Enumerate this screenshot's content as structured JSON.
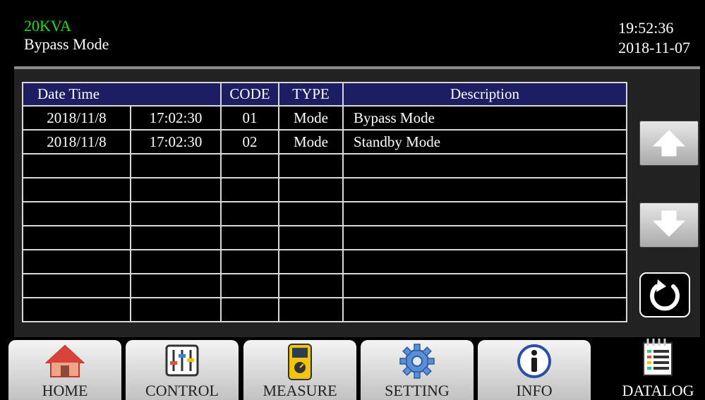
{
  "header": {
    "model": "20KVA",
    "mode": "Bypass Mode",
    "time": "19:52:36",
    "date": "2018-11-07"
  },
  "log_table": {
    "headers": {
      "datetime": "Date Time",
      "code": "CODE",
      "type": "TYPE",
      "description": "Description"
    },
    "rows": [
      {
        "date": "2018/11/8",
        "time": "17:02:30",
        "code": "01",
        "type": "Mode",
        "description": "Bypass Mode"
      },
      {
        "date": "2018/11/8",
        "time": "17:02:30",
        "code": "02",
        "type": "Mode",
        "description": "Standby Mode"
      },
      {
        "date": "",
        "time": "",
        "code": "",
        "type": "",
        "description": ""
      },
      {
        "date": "",
        "time": "",
        "code": "",
        "type": "",
        "description": ""
      },
      {
        "date": "",
        "time": "",
        "code": "",
        "type": "",
        "description": ""
      },
      {
        "date": "",
        "time": "",
        "code": "",
        "type": "",
        "description": ""
      },
      {
        "date": "",
        "time": "",
        "code": "",
        "type": "",
        "description": ""
      },
      {
        "date": "",
        "time": "",
        "code": "",
        "type": "",
        "description": ""
      },
      {
        "date": "",
        "time": "",
        "code": "",
        "type": "",
        "description": ""
      }
    ]
  },
  "side_buttons": {
    "up": "arrow-up-icon",
    "down": "arrow-down-icon",
    "refresh": "refresh-icon"
  },
  "tabs": [
    {
      "label": "HOME",
      "icon": "home-icon"
    },
    {
      "label": "CONTROL",
      "icon": "control-sliders-icon"
    },
    {
      "label": "MEASURE",
      "icon": "meter-icon"
    },
    {
      "label": "SETTING",
      "icon": "gear-icon"
    },
    {
      "label": "INFO",
      "icon": "info-icon"
    },
    {
      "label": "DATALOG",
      "icon": "datalog-icon"
    }
  ],
  "colors": {
    "model_text": "#1ee01e",
    "table_header_bg": "#1c1d63"
  }
}
